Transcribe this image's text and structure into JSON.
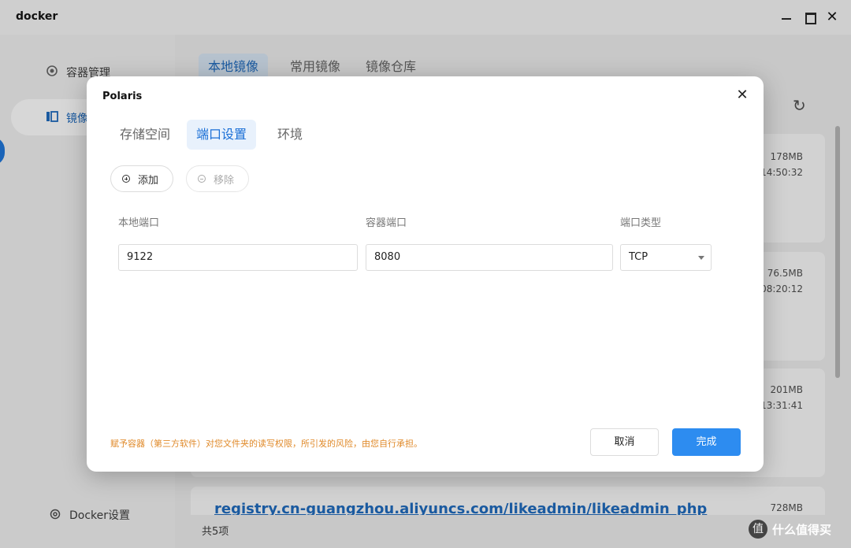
{
  "window": {
    "title": "docker",
    "minimize_icon": "minimize-icon",
    "maximize_icon": "maximize-icon",
    "close_icon": "close-icon"
  },
  "sidebar": {
    "items": [
      {
        "label": "容器管理",
        "icon": "container-icon"
      },
      {
        "label": "镜像",
        "icon": "image-icon"
      }
    ],
    "settings_label": "Docker设置"
  },
  "main": {
    "tabs": [
      {
        "label": "本地镜像"
      },
      {
        "label": "常用镜像"
      },
      {
        "label": "镜像仓库"
      }
    ],
    "cards": [
      {
        "size": "178MB",
        "time": "14:50:32"
      },
      {
        "size": "76.5MB",
        "time": "08:20:12"
      },
      {
        "size": "201MB",
        "time": "13:31:41"
      },
      {
        "size": "728MB"
      }
    ],
    "registry_text": "registry.cn-guangzhou.aliyuncs.com/likeadmin/likeadmin_php",
    "footer_count": "共5项"
  },
  "watermark": {
    "logo": "值",
    "text": "什么值得买"
  },
  "modal": {
    "title": "Polaris",
    "tabs": [
      {
        "label": "存储空间"
      },
      {
        "label": "端口设置"
      },
      {
        "label": "环境"
      }
    ],
    "add_label": "添加",
    "remove_label": "移除",
    "columns": {
      "local_port": "本地端口",
      "container_port": "容器端口",
      "port_type": "端口类型"
    },
    "row": {
      "local_port": "9122",
      "container_port": "8080",
      "port_type": "TCP"
    },
    "warning": "赋予容器（第三方软件）对您文件夹的读写权限，所引发的风险，由您自行承担。",
    "cancel_label": "取消",
    "confirm_label": "完成"
  },
  "colors": {
    "accent": "#2d8cf0",
    "warning": "#e08a2a",
    "tab_active_bg": "#e8f1fc"
  }
}
